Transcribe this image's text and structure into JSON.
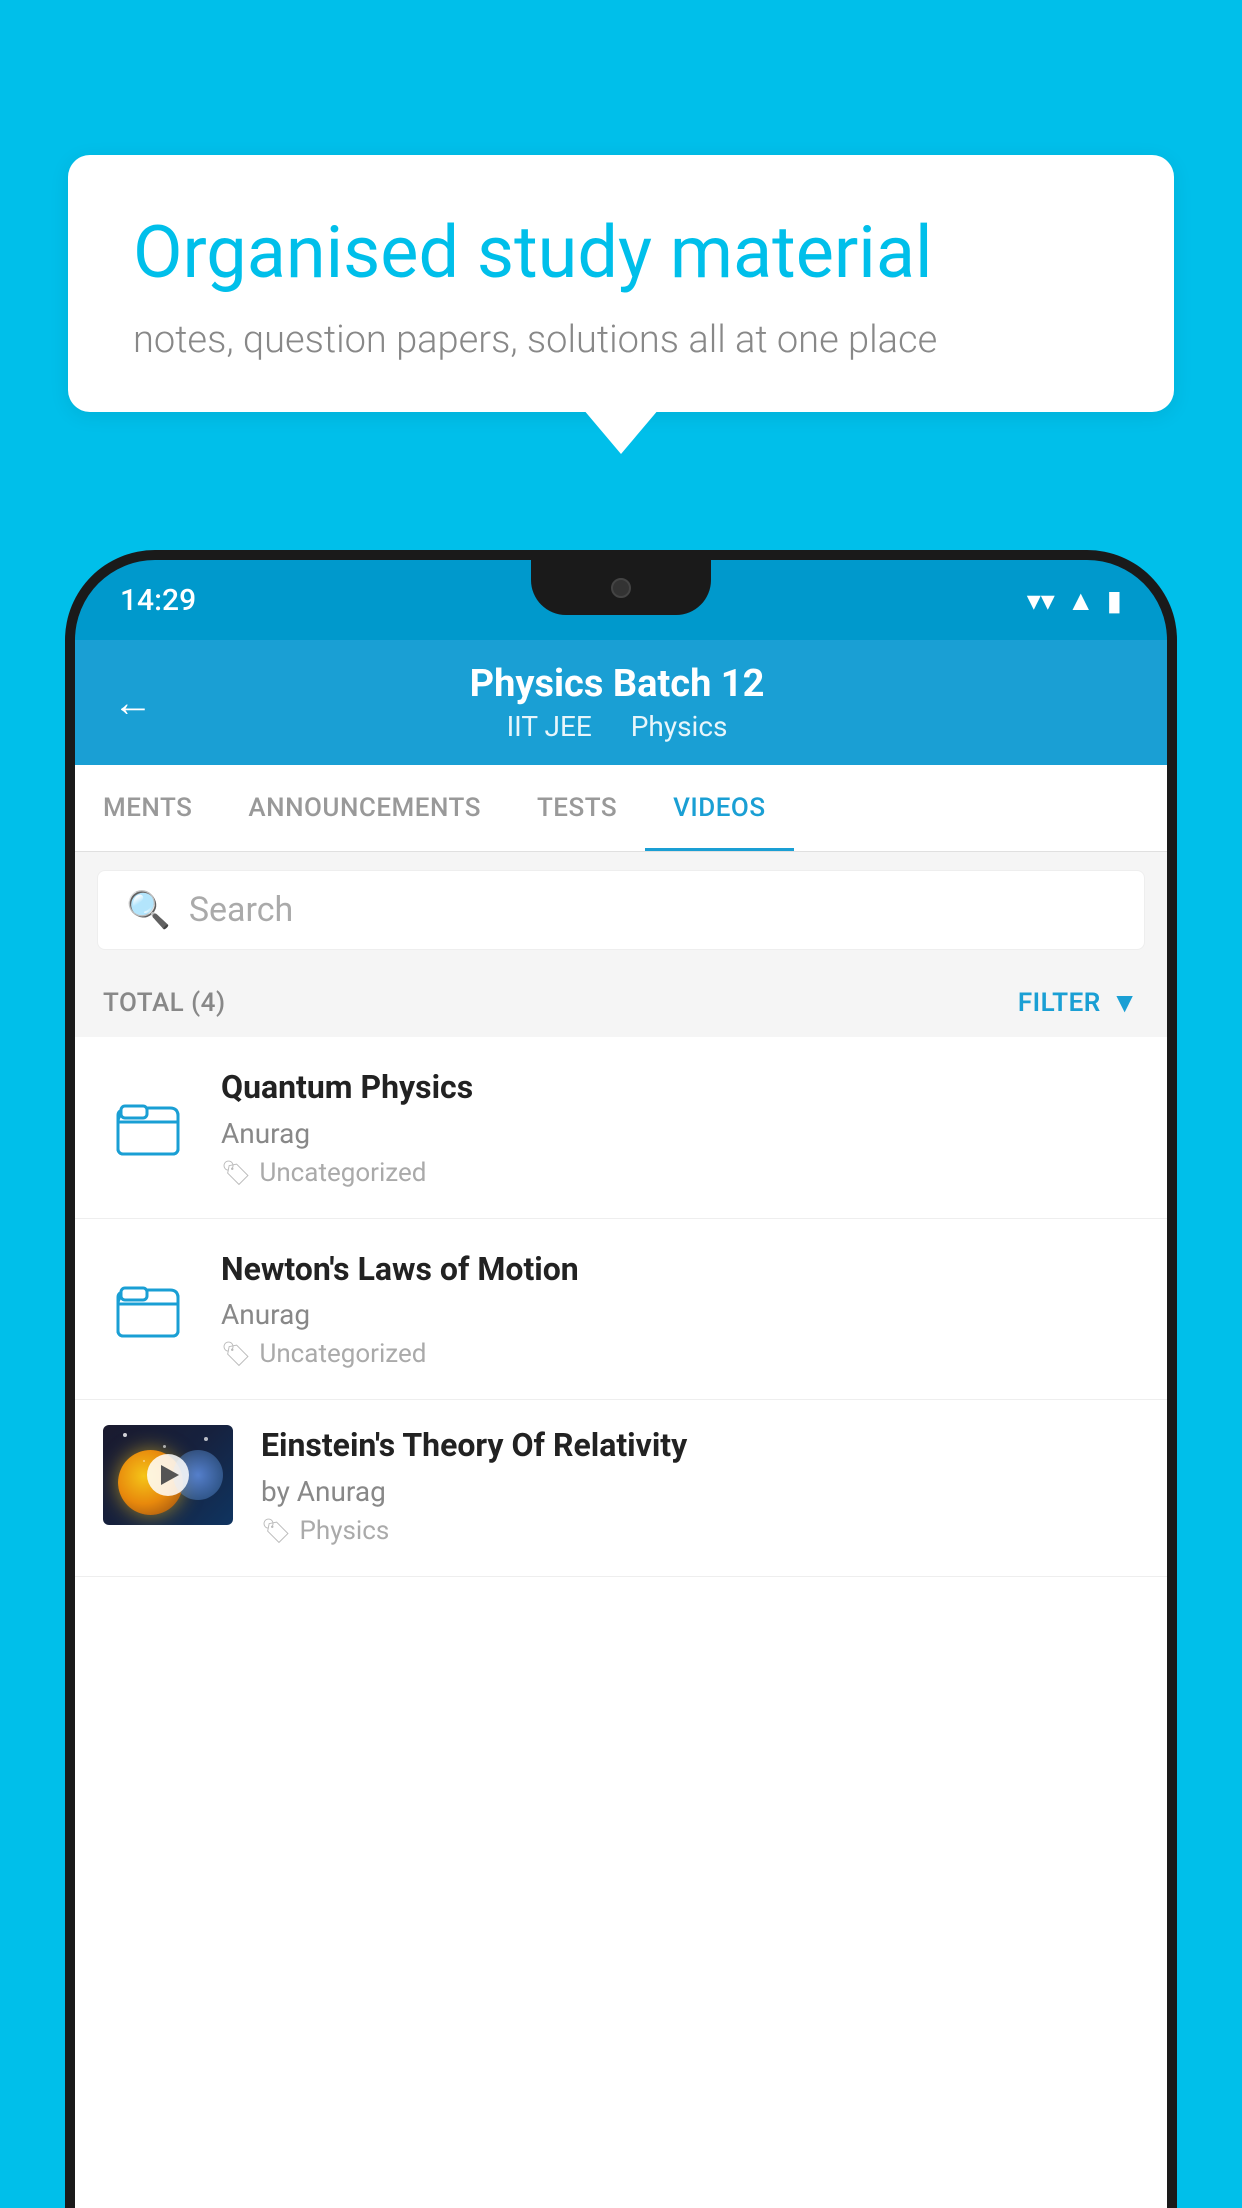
{
  "background_color": "#00BFEA",
  "speech_bubble": {
    "title": "Organised study material",
    "subtitle": "notes, question papers, solutions all at one place"
  },
  "phone": {
    "status_bar": {
      "time": "14:29",
      "icons": [
        "wifi",
        "signal",
        "battery"
      ]
    },
    "header": {
      "title": "Physics Batch 12",
      "subtitle_parts": [
        "IIT JEE",
        "Physics"
      ],
      "back_label": "←"
    },
    "tabs": [
      {
        "label": "MENTS",
        "active": false
      },
      {
        "label": "ANNOUNCEMENTS",
        "active": false
      },
      {
        "label": "TESTS",
        "active": false
      },
      {
        "label": "VIDEOS",
        "active": true
      }
    ],
    "search": {
      "placeholder": "Search"
    },
    "filter_bar": {
      "total_label": "TOTAL (4)",
      "filter_label": "FILTER"
    },
    "videos": [
      {
        "id": 1,
        "title": "Quantum Physics",
        "author": "Anurag",
        "tag": "Uncategorized",
        "type": "folder",
        "has_thumbnail": false
      },
      {
        "id": 2,
        "title": "Newton's Laws of Motion",
        "author": "Anurag",
        "tag": "Uncategorized",
        "type": "folder",
        "has_thumbnail": false
      },
      {
        "id": 3,
        "title": "Einstein's Theory Of Relativity",
        "author": "by Anurag",
        "tag": "Physics",
        "type": "video",
        "has_thumbnail": true
      }
    ]
  }
}
